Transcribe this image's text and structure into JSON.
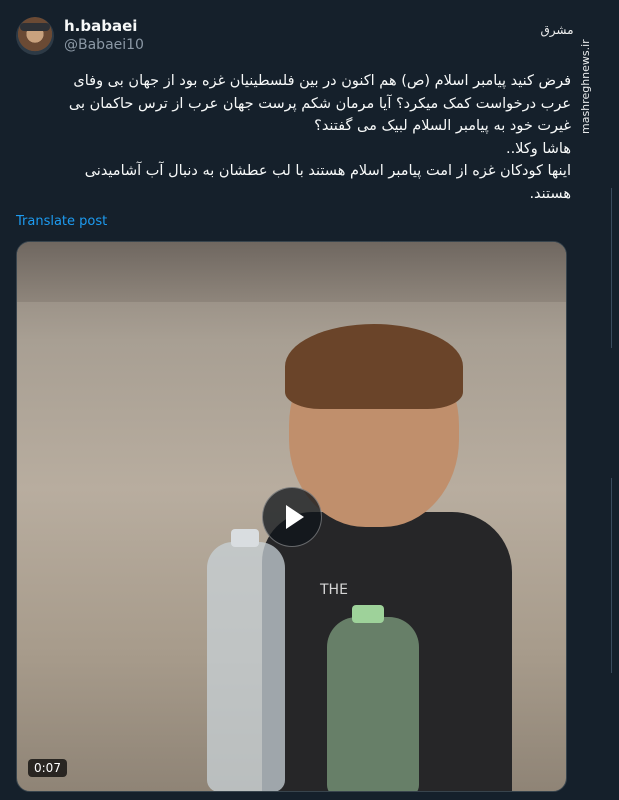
{
  "author": {
    "display_name": "h.babaei",
    "handle": "@Babaei10"
  },
  "watermark": {
    "logo_text": "مشرق",
    "url": "mashreghnews.ir"
  },
  "tweet": {
    "lines": [
      "فرض کنید پیامبر اسلام (ص) هم اکنون در بین فلسطینیان غزه بود از جهان بی وفای",
      "عرب درخواست کمک میکرد؟ آیا مرمان شکم پرست جهان عرب از ترس حاکمان بی",
      "غیرت خود به پیامبر السلام لبیک می گفتند؟",
      "هاشا وکلا..",
      "اینها کودکان غزه از امت پیامبر اسلام هستند با لب عطشان به دنبال آب آشامیدنی",
      "هستند."
    ],
    "translate_label": "Translate post"
  },
  "video": {
    "duration": "0:07",
    "shirt_text": "THE"
  },
  "icons": {
    "play": "play-icon"
  }
}
